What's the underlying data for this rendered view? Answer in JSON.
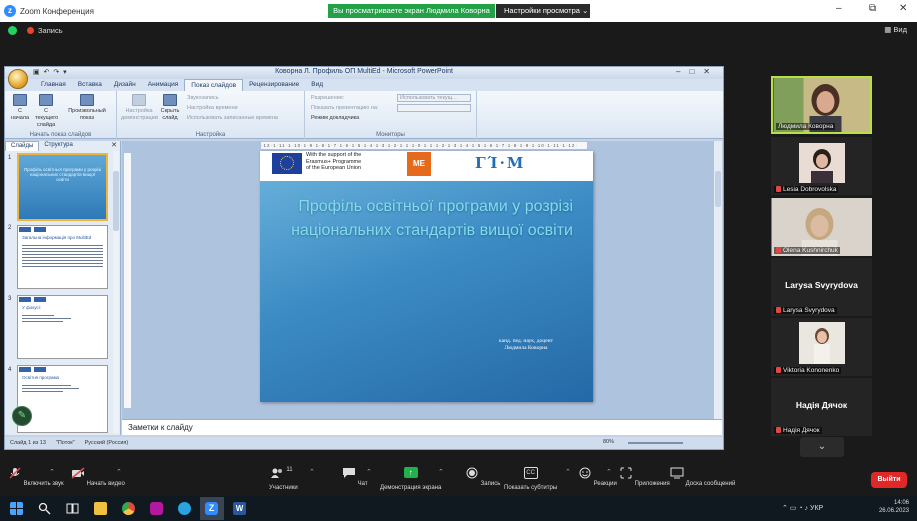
{
  "titlebar": {
    "app_title": "Zoom Конференция",
    "share_banner": "Вы просматриваете экран Людмила Коворна",
    "view_options": "Настройки просмотра",
    "minimize": "–",
    "maximize": "⧉",
    "close": "✕"
  },
  "zoom_top": {
    "recording": "Запись",
    "view": "Вид"
  },
  "ppt": {
    "window_title": "Коворна Л. Профиль ОП МultiEd - Microsoft PowerPoint",
    "tabs": [
      "Главная",
      "Вставка",
      "Дизайн",
      "Анимация",
      "Показ слайдов",
      "Рецензирование",
      "Вид"
    ],
    "ribbon": {
      "group1_label": "Начать показ слайдов",
      "btn_from_start": "С начала",
      "btn_from_current": "С текущего слайда",
      "btn_custom": "Произвольный показ",
      "group2_label": "Настройка",
      "btn_setup": "Настройка демонстрации",
      "btn_hide": "Скрыть слайд",
      "rehearse": "Звукозапись",
      "timings": "Настройка времени",
      "use_timings": "Использовать записанные времена",
      "group3_label": "Мониторы",
      "resolution_label": "Разрешение:",
      "resolution_value": "Использовать текущ...",
      "show_on_label": "Показать презентацию на:",
      "presenter_view": "Режим докладчика"
    },
    "pane_tabs": [
      "Слайды",
      "Структура"
    ],
    "thumbs": [
      {
        "num": "1",
        "text": "Профіль освітньої програми у розрізі національних стандартів вищої освіти"
      },
      {
        "num": "2",
        "text": "Загальна інформація про MultiEd"
      },
      {
        "num": "3",
        "text": "У фокусі:"
      },
      {
        "num": "4",
        "text": "Освітня програма"
      }
    ],
    "ruler": "·12·1·11·1·10·1·9·1·8·1·7·1·6·1·5·1·4·1·3·1·2·1·1·1·0·1·1·1·2·1·3·1·4·1·5·1·6·1·7·1·8·1·9·1·10·1·11·1·12·",
    "slide": {
      "erasmus_line1": "With the support of the",
      "erasmus_line2": "Erasmus+ Programme",
      "erasmus_line3": "of the European Union",
      "me_logo": "ME",
      "gm_logo": "ΓΊ·М",
      "title": "Профіль освітньої програми у розрізі національних стандартів вищої освіти",
      "author_line1": "канд. пед. наук, доцент",
      "author_line2": "Людмила Коворна"
    },
    "notes": "Заметки к слайду",
    "status": {
      "slide_of": "Слайд 1 из 13",
      "theme": "\"Поток\"",
      "language": "Русский (Россия)",
      "zoom": "80%"
    }
  },
  "participants": [
    {
      "name": "Людмила Коворна",
      "type": "video"
    },
    {
      "name": "Lesia Dobrovolska",
      "type": "photo"
    },
    {
      "name": "Olena Kushnirchuk",
      "type": "video"
    },
    {
      "name": "Larysa Svyrydova",
      "big": "Larysa Svyrydova",
      "type": "name"
    },
    {
      "name": "Viktoria Kononenko",
      "type": "photo"
    },
    {
      "name": "Надія Дячок",
      "big": "Надія Дячок",
      "type": "name"
    }
  ],
  "toolbar": {
    "audio": "Включить звук",
    "video": "Начать видео",
    "participants": "Участники",
    "participants_count": "11",
    "chat": "Чат",
    "share": "Демонстрация экрана",
    "record": "Запись",
    "captions": "Показать субтитры",
    "captions_icon": "CC",
    "reactions": "Реакции",
    "apps": "Приложения",
    "whiteboards": "Доска сообщений",
    "leave": "Выйти"
  },
  "taskbar": {
    "time": "14:06",
    "date": "26.06.2023",
    "lang": "УКР"
  },
  "colors": {
    "zoom_green": "#22a147",
    "leave_red": "#e02828",
    "slide_title": "#7fdcf0",
    "speaker_border": "#b6e04a"
  }
}
